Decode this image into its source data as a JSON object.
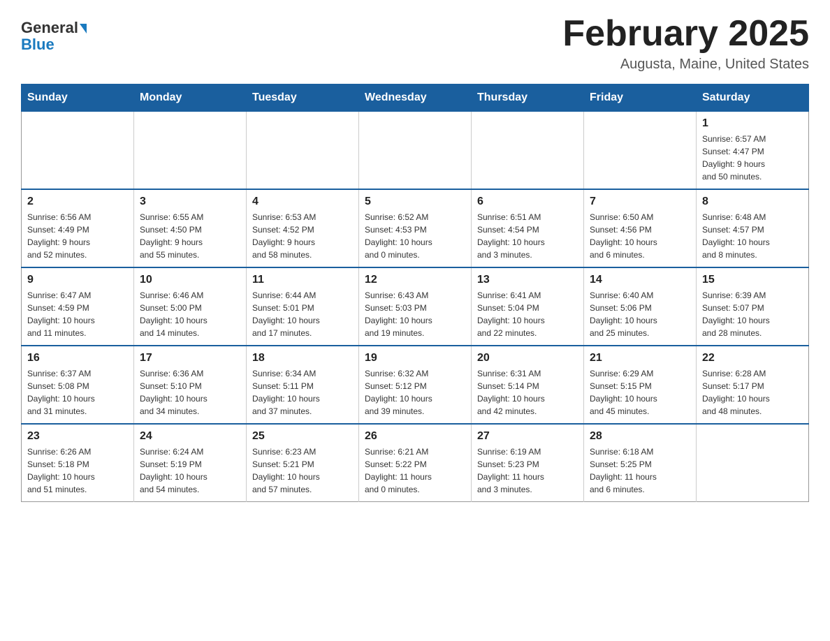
{
  "header": {
    "logo_general": "General",
    "logo_blue": "Blue",
    "title": "February 2025",
    "subtitle": "Augusta, Maine, United States"
  },
  "days_of_week": [
    "Sunday",
    "Monday",
    "Tuesday",
    "Wednesday",
    "Thursday",
    "Friday",
    "Saturday"
  ],
  "weeks": [
    [
      {
        "day": "",
        "info": "",
        "empty": true
      },
      {
        "day": "",
        "info": "",
        "empty": true
      },
      {
        "day": "",
        "info": "",
        "empty": true
      },
      {
        "day": "",
        "info": "",
        "empty": true
      },
      {
        "day": "",
        "info": "",
        "empty": true
      },
      {
        "day": "",
        "info": "",
        "empty": true
      },
      {
        "day": "1",
        "info": "Sunrise: 6:57 AM\nSunset: 4:47 PM\nDaylight: 9 hours\nand 50 minutes.",
        "empty": false
      }
    ],
    [
      {
        "day": "2",
        "info": "Sunrise: 6:56 AM\nSunset: 4:49 PM\nDaylight: 9 hours\nand 52 minutes.",
        "empty": false
      },
      {
        "day": "3",
        "info": "Sunrise: 6:55 AM\nSunset: 4:50 PM\nDaylight: 9 hours\nand 55 minutes.",
        "empty": false
      },
      {
        "day": "4",
        "info": "Sunrise: 6:53 AM\nSunset: 4:52 PM\nDaylight: 9 hours\nand 58 minutes.",
        "empty": false
      },
      {
        "day": "5",
        "info": "Sunrise: 6:52 AM\nSunset: 4:53 PM\nDaylight: 10 hours\nand 0 minutes.",
        "empty": false
      },
      {
        "day": "6",
        "info": "Sunrise: 6:51 AM\nSunset: 4:54 PM\nDaylight: 10 hours\nand 3 minutes.",
        "empty": false
      },
      {
        "day": "7",
        "info": "Sunrise: 6:50 AM\nSunset: 4:56 PM\nDaylight: 10 hours\nand 6 minutes.",
        "empty": false
      },
      {
        "day": "8",
        "info": "Sunrise: 6:48 AM\nSunset: 4:57 PM\nDaylight: 10 hours\nand 8 minutes.",
        "empty": false
      }
    ],
    [
      {
        "day": "9",
        "info": "Sunrise: 6:47 AM\nSunset: 4:59 PM\nDaylight: 10 hours\nand 11 minutes.",
        "empty": false
      },
      {
        "day": "10",
        "info": "Sunrise: 6:46 AM\nSunset: 5:00 PM\nDaylight: 10 hours\nand 14 minutes.",
        "empty": false
      },
      {
        "day": "11",
        "info": "Sunrise: 6:44 AM\nSunset: 5:01 PM\nDaylight: 10 hours\nand 17 minutes.",
        "empty": false
      },
      {
        "day": "12",
        "info": "Sunrise: 6:43 AM\nSunset: 5:03 PM\nDaylight: 10 hours\nand 19 minutes.",
        "empty": false
      },
      {
        "day": "13",
        "info": "Sunrise: 6:41 AM\nSunset: 5:04 PM\nDaylight: 10 hours\nand 22 minutes.",
        "empty": false
      },
      {
        "day": "14",
        "info": "Sunrise: 6:40 AM\nSunset: 5:06 PM\nDaylight: 10 hours\nand 25 minutes.",
        "empty": false
      },
      {
        "day": "15",
        "info": "Sunrise: 6:39 AM\nSunset: 5:07 PM\nDaylight: 10 hours\nand 28 minutes.",
        "empty": false
      }
    ],
    [
      {
        "day": "16",
        "info": "Sunrise: 6:37 AM\nSunset: 5:08 PM\nDaylight: 10 hours\nand 31 minutes.",
        "empty": false
      },
      {
        "day": "17",
        "info": "Sunrise: 6:36 AM\nSunset: 5:10 PM\nDaylight: 10 hours\nand 34 minutes.",
        "empty": false
      },
      {
        "day": "18",
        "info": "Sunrise: 6:34 AM\nSunset: 5:11 PM\nDaylight: 10 hours\nand 37 minutes.",
        "empty": false
      },
      {
        "day": "19",
        "info": "Sunrise: 6:32 AM\nSunset: 5:12 PM\nDaylight: 10 hours\nand 39 minutes.",
        "empty": false
      },
      {
        "day": "20",
        "info": "Sunrise: 6:31 AM\nSunset: 5:14 PM\nDaylight: 10 hours\nand 42 minutes.",
        "empty": false
      },
      {
        "day": "21",
        "info": "Sunrise: 6:29 AM\nSunset: 5:15 PM\nDaylight: 10 hours\nand 45 minutes.",
        "empty": false
      },
      {
        "day": "22",
        "info": "Sunrise: 6:28 AM\nSunset: 5:17 PM\nDaylight: 10 hours\nand 48 minutes.",
        "empty": false
      }
    ],
    [
      {
        "day": "23",
        "info": "Sunrise: 6:26 AM\nSunset: 5:18 PM\nDaylight: 10 hours\nand 51 minutes.",
        "empty": false
      },
      {
        "day": "24",
        "info": "Sunrise: 6:24 AM\nSunset: 5:19 PM\nDaylight: 10 hours\nand 54 minutes.",
        "empty": false
      },
      {
        "day": "25",
        "info": "Sunrise: 6:23 AM\nSunset: 5:21 PM\nDaylight: 10 hours\nand 57 minutes.",
        "empty": false
      },
      {
        "day": "26",
        "info": "Sunrise: 6:21 AM\nSunset: 5:22 PM\nDaylight: 11 hours\nand 0 minutes.",
        "empty": false
      },
      {
        "day": "27",
        "info": "Sunrise: 6:19 AM\nSunset: 5:23 PM\nDaylight: 11 hours\nand 3 minutes.",
        "empty": false
      },
      {
        "day": "28",
        "info": "Sunrise: 6:18 AM\nSunset: 5:25 PM\nDaylight: 11 hours\nand 6 minutes.",
        "empty": false
      },
      {
        "day": "",
        "info": "",
        "empty": true
      }
    ]
  ]
}
